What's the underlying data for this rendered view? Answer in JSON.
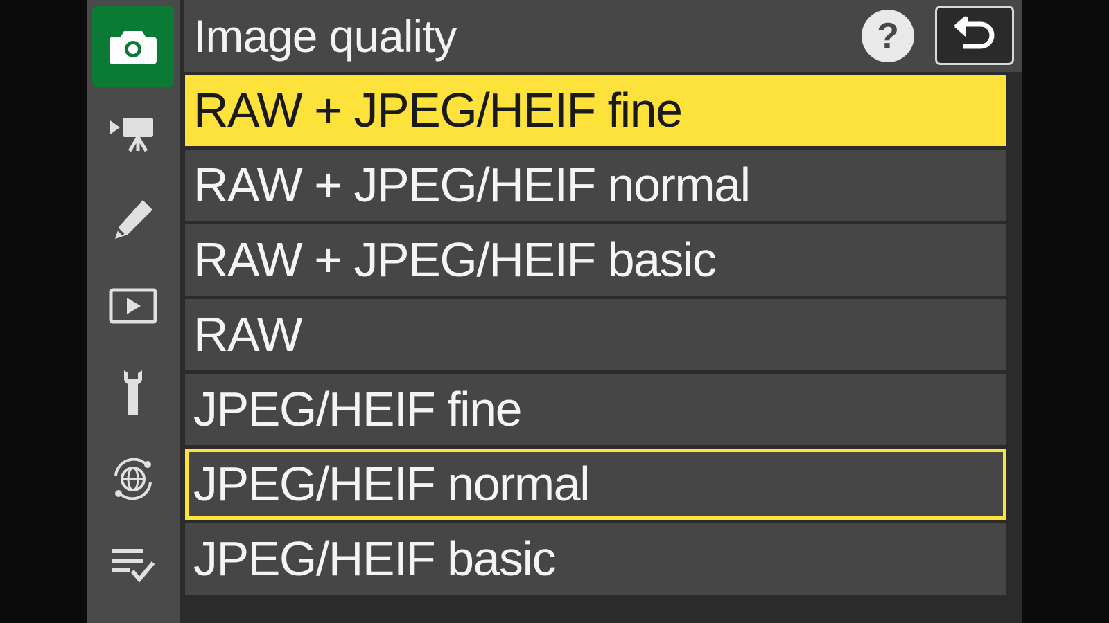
{
  "header": {
    "title": "Image quality",
    "help_label": "?"
  },
  "sidebar": {
    "items": [
      {
        "icon": "camera-icon",
        "active": true
      },
      {
        "icon": "movie-camera-icon",
        "active": false
      },
      {
        "icon": "pencil-icon",
        "active": false
      },
      {
        "icon": "playback-icon",
        "active": false
      },
      {
        "icon": "wrench-icon",
        "active": false
      },
      {
        "icon": "network-globe-icon",
        "active": false
      },
      {
        "icon": "my-menu-checklist-icon",
        "active": false
      }
    ]
  },
  "options": [
    {
      "label": "RAW + JPEG/HEIF fine",
      "state": "highlighted"
    },
    {
      "label": "RAW + JPEG/HEIF normal",
      "state": ""
    },
    {
      "label": "RAW + JPEG/HEIF basic",
      "state": ""
    },
    {
      "label": "RAW",
      "state": ""
    },
    {
      "label": "JPEG/HEIF fine",
      "state": ""
    },
    {
      "label": "JPEG/HEIF normal",
      "state": "current"
    },
    {
      "label": "JPEG/HEIF basic",
      "state": ""
    }
  ],
  "colors": {
    "highlight": "#fde23c",
    "active_tab": "#0a7a35",
    "row_background": "#464646"
  }
}
